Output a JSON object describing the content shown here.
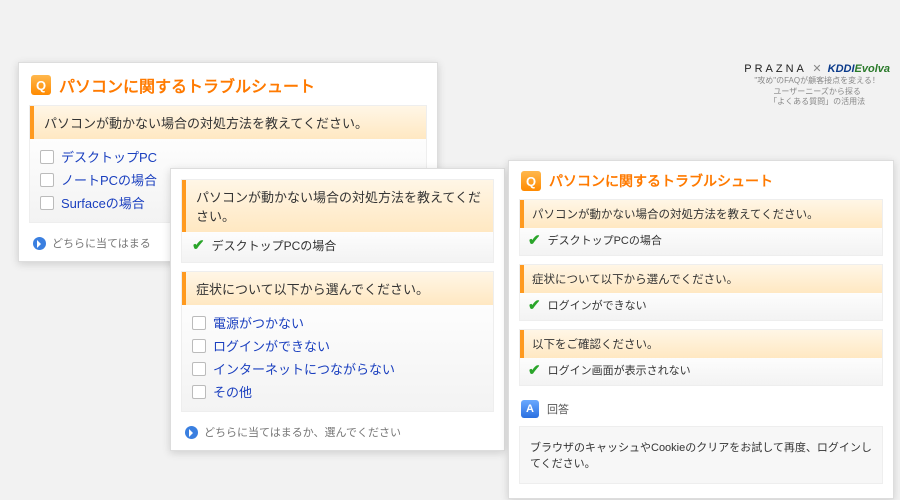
{
  "header": {
    "brand_left": "PRAZNA",
    "brand_x": "✕",
    "brand_kddi": "KDDI",
    "brand_evolva": "Evolva",
    "tag1": "\"攻め\"のFAQが顧客接点を変える！",
    "tag2": "ユーザーニーズから探る",
    "tag3": "「よくある質問」の活用法"
  },
  "q_label": "Q",
  "a_label": "A",
  "title": "パソコンに関するトラブルシュート",
  "prompt_main": "パソコンが動かない場合の対処方法を教えてください。",
  "prompt_symptom": "症状について以下から選んでください。",
  "prompt_confirm": "以下をご確認ください。",
  "hint": "どちらに当てはまるか、選んでください",
  "hint_short": "どちらに当てはまる",
  "panel1": {
    "opts": [
      {
        "label": "デスクトップPC"
      },
      {
        "label": "ノートPCの場合"
      },
      {
        "label": "Surfaceの場合"
      }
    ]
  },
  "panel2": {
    "selected1": "デスクトップPCの場合",
    "opts": [
      {
        "label": "電源がつかない"
      },
      {
        "label": "ログインができない"
      },
      {
        "label": "インターネットにつながらない"
      },
      {
        "label": "その他"
      }
    ]
  },
  "panel3": {
    "selected1": "デスクトップPCの場合",
    "selected2": "ログインができない",
    "selected3": "ログイン画面が表示されない",
    "answer_title": "回答",
    "answer_body": "ブラウザのキャッシュやCookieのクリアをお試して再度、ログインしてください。"
  }
}
